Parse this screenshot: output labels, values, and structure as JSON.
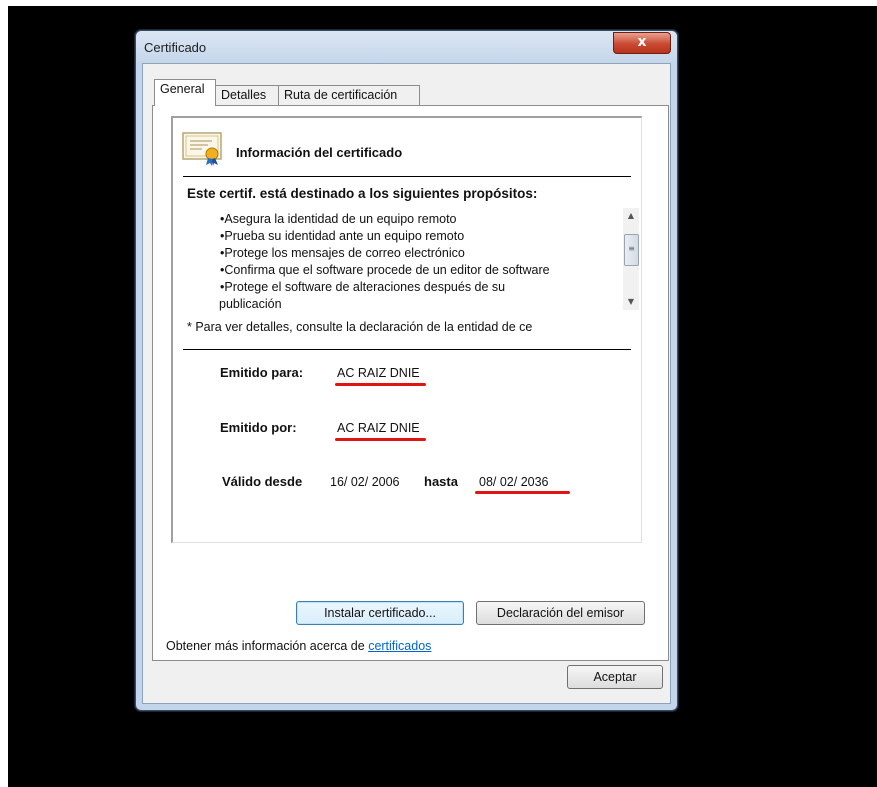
{
  "window": {
    "title": "Certificado",
    "close_glyph": "x"
  },
  "tabs": [
    {
      "label": "General",
      "active": true
    },
    {
      "label": "Detalles",
      "active": false
    },
    {
      "label": "Ruta de certificación",
      "active": false
    }
  ],
  "cert_info": {
    "title": "Información del certificado",
    "purpose_heading": "Este certif. está destinado a los siguientes propósitos:",
    "purposes": [
      "Asegura la identidad de un equipo remoto",
      "Prueba su identidad ante un equipo remoto",
      "Protege los mensajes de correo electrónico",
      "Confirma que el software procede de un editor de software",
      "Protege el software de alteraciones después de su"
    ],
    "purpose_continuation": "publicación",
    "note": "* Para ver detalles, consulte la declaración de la entidad de ce",
    "issued_to_label": "Emitido para:",
    "issued_to_value": "AC RAIZ DNIE",
    "issued_by_label": "Emitido por:",
    "issued_by_value": "AC RAIZ DNIE",
    "valid_from_label": "Válido desde",
    "valid_from_value": "16/ 02/ 2006",
    "valid_to_label": "hasta",
    "valid_to_value": "08/ 02/ 2036"
  },
  "buttons": {
    "install": "Instalar certificado...",
    "issuer_statement": "Declaración del emisor",
    "accept": "Aceptar"
  },
  "more_info": {
    "text": "Obtener más información acerca de ",
    "link": "certificados"
  },
  "colors": {
    "annotation_red": "#e11414",
    "link_blue": "#0066cc",
    "close_red": "#c94a31"
  },
  "icons": {
    "certificate": "certificate-icon",
    "scroll_up": "scroll-up-arrow-icon",
    "scroll_down": "scroll-down-arrow-icon",
    "close": "close-icon"
  }
}
